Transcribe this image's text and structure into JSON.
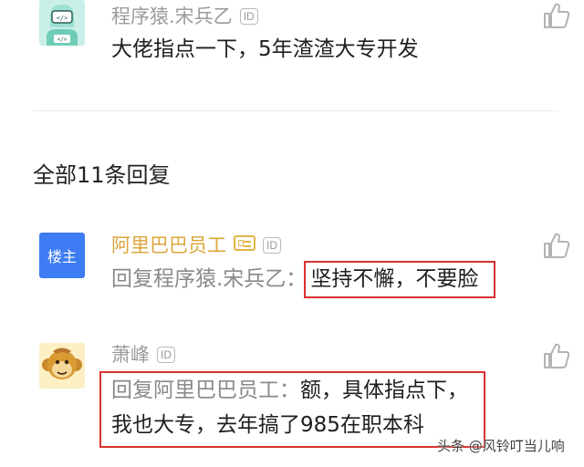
{
  "top_comment": {
    "author": "程序猿.宋兵乙",
    "id_badge": "ID",
    "text": "大佬指点一下，5年渣渣大专开发"
  },
  "replies_header": "全部11条回复",
  "replies": [
    {
      "author": "阿里巴巴员工",
      "avatar_label": "楼主",
      "id_badge": "ID",
      "reply_prefix": "回复程序猿.宋兵乙：",
      "text": "坚持不懈，不要脸"
    },
    {
      "author": "萧峰",
      "id_badge": "ID",
      "line1_prefix": "回复阿里巴巴员工：",
      "line1_text": "额，具体指点下，",
      "line2_text": "我也大专，去年搞了985在职本科"
    }
  ],
  "watermark": "头条 @风铃叮当儿响",
  "colors": {
    "author_muted": "#9b9b9b",
    "author_vip": "#dba63a",
    "reply_prefix": "#8a8a8a",
    "host_avatar_bg": "#3d7cf2",
    "highlight_border": "#d8322f"
  },
  "icons": [
    "coder-avatar",
    "thumbs-up-icon",
    "vip-badge-icon",
    "monkey-avatar"
  ]
}
